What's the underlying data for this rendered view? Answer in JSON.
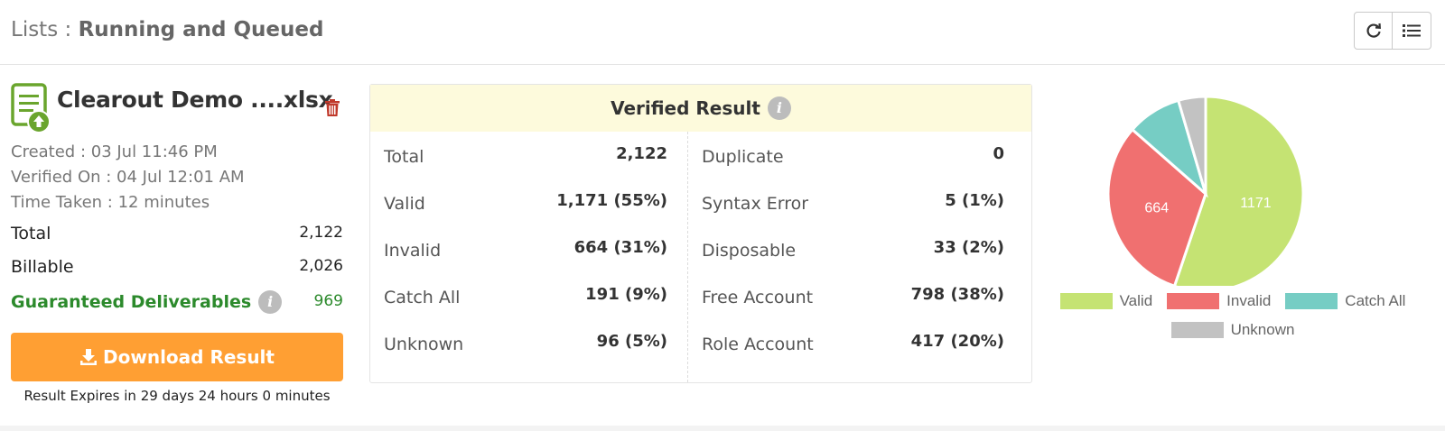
{
  "header": {
    "prefix": "Lists : ",
    "title": "Running and Queued",
    "refresh_icon": "refresh-icon",
    "list_icon": "list-icon"
  },
  "file": {
    "name": "Clearout Demo ....xlsx",
    "created": "Created : 03 Jul 11:46 PM",
    "verified_on": "Verified On : 04 Jul 12:01 AM",
    "time_taken": "Time Taken : 12 minutes",
    "total_label": "Total",
    "total_value": "2,122",
    "billable_label": "Billable",
    "billable_value": "2,026",
    "guaranteed_label": "Guaranteed Deliverables",
    "guaranteed_value": "969",
    "download_label": "Download Result",
    "expires": "Result Expires in 29 days 24 hours 0 minutes"
  },
  "verified_result": {
    "title": "Verified Result",
    "left": [
      {
        "label": "Total",
        "value": "2,122"
      },
      {
        "label": "Valid",
        "value": "1,171 (55%)"
      },
      {
        "label": "Invalid",
        "value": "664 (31%)"
      },
      {
        "label": "Catch All",
        "value": "191 (9%)"
      },
      {
        "label": "Unknown",
        "value": "96 (5%)"
      }
    ],
    "right": [
      {
        "label": "Duplicate",
        "value": "0"
      },
      {
        "label": "Syntax Error",
        "value": "5 (1%)"
      },
      {
        "label": "Disposable",
        "value": "33 (2%)"
      },
      {
        "label": "Free Account",
        "value": "798 (38%)"
      },
      {
        "label": "Role Account",
        "value": "417 (20%)"
      }
    ]
  },
  "colors": {
    "valid": "#c5e373",
    "invalid": "#f07070",
    "catch_all": "#76cdc4",
    "unknown": "#c2c2c2",
    "download": "#ff9f33",
    "guaranteed": "#2c8a2c"
  },
  "chart_data": {
    "type": "pie",
    "categories": [
      "Valid",
      "Invalid",
      "Catch All",
      "Unknown"
    ],
    "values": [
      1171,
      664,
      191,
      96
    ],
    "data_labels": [
      "1171",
      "664",
      "",
      ""
    ],
    "legend": "bottom"
  }
}
